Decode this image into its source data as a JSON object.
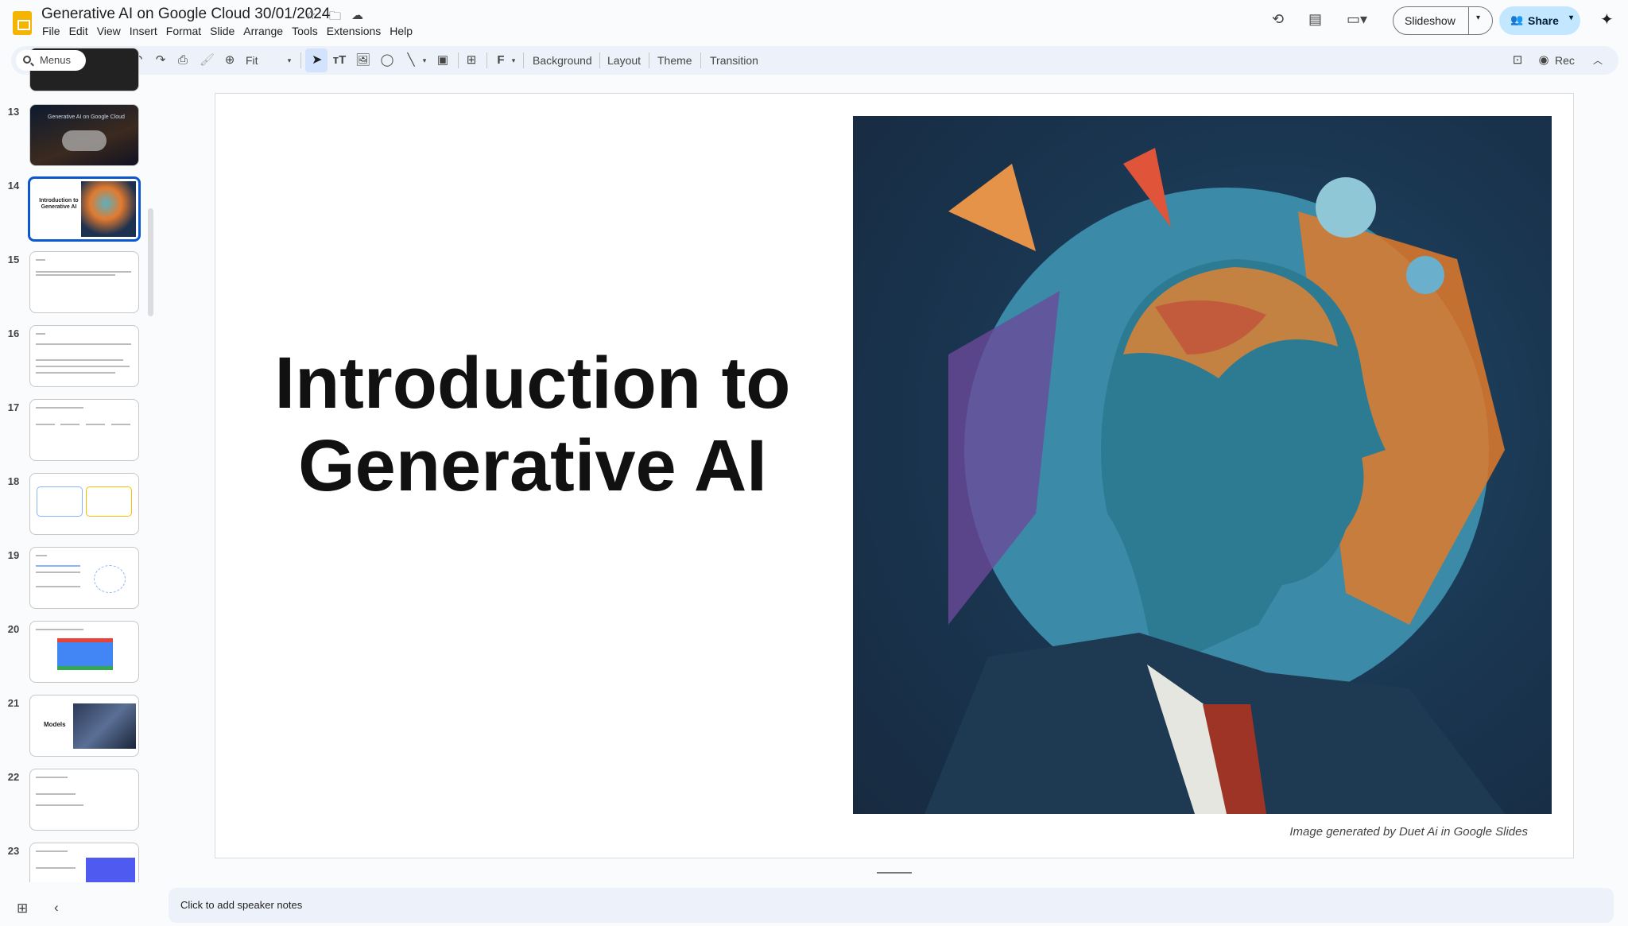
{
  "app": {
    "title": "Generative AI on Google Cloud 30/01/2024",
    "menus": [
      "File",
      "Edit",
      "View",
      "Insert",
      "Format",
      "Slide",
      "Arrange",
      "Tools",
      "Extensions",
      "Help"
    ]
  },
  "toolbar": {
    "search": "Menus",
    "zoom": "Fit",
    "background": "Background",
    "layout": "Layout",
    "theme": "Theme",
    "transition": "Transition",
    "rec": "Rec"
  },
  "header": {
    "slideshow": "Slideshow",
    "share": "Share"
  },
  "filmstrip": {
    "slides": [
      {
        "num": "13",
        "text": "Generative AI on Google Cloud"
      },
      {
        "num": "14",
        "text": "Introduction to Generative AI",
        "selected": true
      },
      {
        "num": "15"
      },
      {
        "num": "16"
      },
      {
        "num": "17"
      },
      {
        "num": "18"
      },
      {
        "num": "19"
      },
      {
        "num": "20"
      },
      {
        "num": "21",
        "text": "Models"
      },
      {
        "num": "22"
      },
      {
        "num": "23"
      }
    ]
  },
  "slide": {
    "title": "Introduction to Generative AI",
    "caption": "Image generated by Duet Ai in Google Slides"
  },
  "notes": {
    "placeholder": "Click to add speaker notes"
  },
  "colors": {
    "accent": "#0b57d0",
    "share_bg": "#c2e7ff",
    "logo": "#f4b400"
  }
}
